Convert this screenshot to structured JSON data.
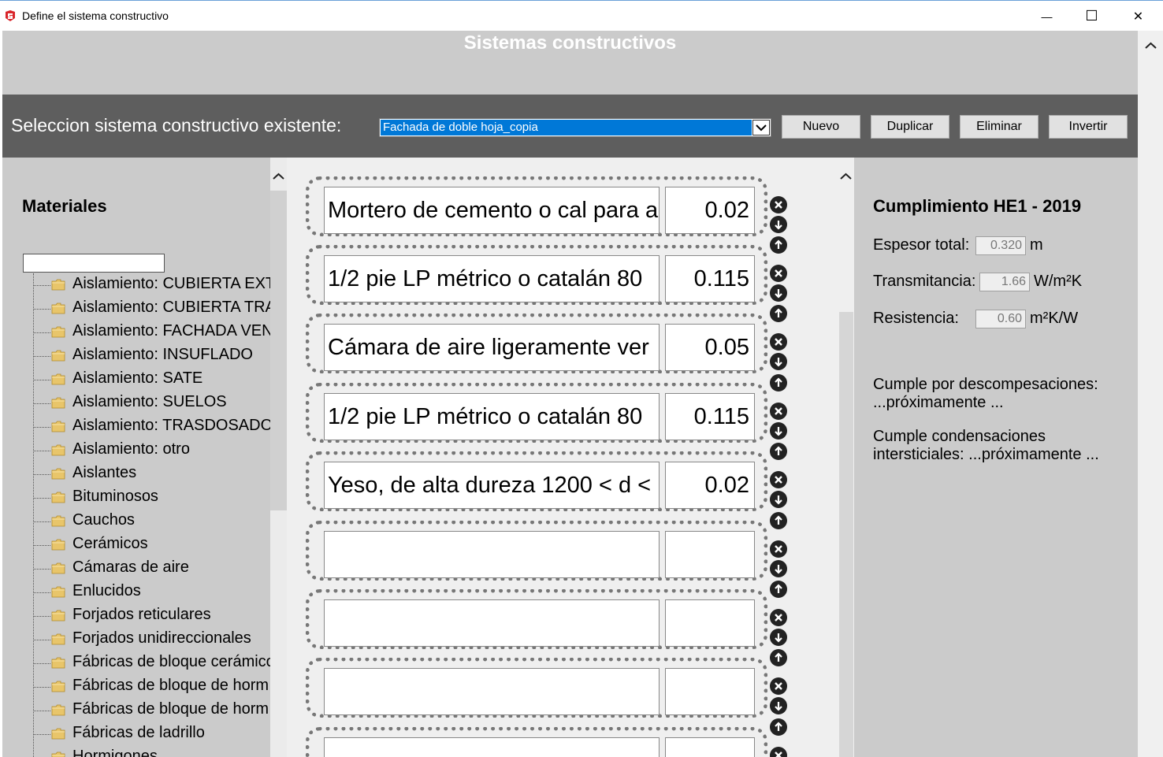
{
  "window": {
    "title": "Define el sistema constructivo",
    "minimize_glyph": "—",
    "maximize_glyph": "☐",
    "close_glyph": "✕"
  },
  "header": {
    "title": "Sistemas constructivos"
  },
  "toolbar": {
    "label": "Seleccion sistema constructivo existente:",
    "selected_system": "Fachada de doble hoja_copia",
    "buttons": [
      "Nuevo",
      "Duplicar",
      "Eliminar",
      "Invertir"
    ]
  },
  "materials": {
    "title": "Materiales",
    "search_value": "",
    "items": [
      "Aislamiento: CUBIERTA EXT",
      "Aislamiento: CUBIERTA TRA",
      "Aislamiento: FACHADA VEN",
      "Aislamiento: INSUFLADO",
      "Aislamiento: SATE",
      "Aislamiento: SUELOS",
      "Aislamiento: TRASDOSADO",
      "Aislamiento: otro",
      "Aislantes",
      "Bituminosos",
      "Cauchos",
      "Cerámicos",
      "Cámaras de aire",
      "Enlucidos",
      "Forjados reticulares",
      "Forjados unidireccionales",
      "Fábricas de bloque cerámico",
      "Fábricas de bloque de horm",
      "Fábricas de bloque de horm",
      "Fábricas de ladrillo",
      "Hormigones"
    ]
  },
  "layers": [
    {
      "name": "Mortero de cemento o cal para a",
      "thickness": "0.02"
    },
    {
      "name": "1/2 pie LP métrico o catalán 80",
      "thickness": "0.115"
    },
    {
      "name": "Cámara de aire ligeramente ver",
      "thickness": "0.05"
    },
    {
      "name": "1/2 pie LP métrico o catalán 80",
      "thickness": "0.115"
    },
    {
      "name": "Yeso, de alta dureza 1200 < d <",
      "thickness": "0.02"
    },
    {
      "name": "",
      "thickness": ""
    },
    {
      "name": "",
      "thickness": ""
    },
    {
      "name": "",
      "thickness": ""
    },
    {
      "name": "",
      "thickness": ""
    }
  ],
  "compliance": {
    "title": "Cumplimiento HE1 - 2019",
    "espesor_label": "Espesor total:",
    "espesor_value": "0.320",
    "espesor_unit": "m",
    "transmitancia_label": "Transmitancia:",
    "transmitancia_value": "1.66",
    "transmitancia_unit": "W/m²K",
    "resistencia_label": "Resistencia:",
    "resistencia_value": "0.60",
    "resistencia_unit": "m²K/W",
    "descompensaciones_line1": "Cumple por descompesaciones:",
    "descompensaciones_line2": "...próximamente ...",
    "condensaciones_line1": "Cumple condensaciones",
    "condensaciones_line2": "intersticiales: ...próximamente ..."
  }
}
